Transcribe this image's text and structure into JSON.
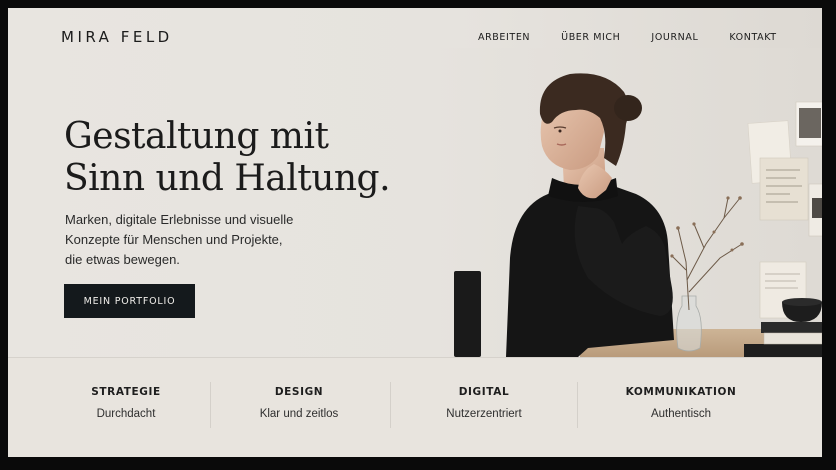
{
  "header": {
    "logo": "MIRA FELD",
    "nav": [
      {
        "label": "ARBEITEN"
      },
      {
        "label": "ÜBER MICH"
      },
      {
        "label": "JOURNAL"
      },
      {
        "label": "KONTAKT"
      }
    ]
  },
  "hero": {
    "headline_line1": "Gestaltung mit",
    "headline_line2": "Sinn und Haltung.",
    "sub_line1": "Marken, digitale Erlebnisse und visuelle",
    "sub_line2": "Konzepte für Menschen und Projekte,",
    "sub_line3": "die etwas bewegen.",
    "cta_label": "MEIN PORTFOLIO"
  },
  "features": [
    {
      "title": "STRATEGIE",
      "subtitle": "Durchdacht"
    },
    {
      "title": "DESIGN",
      "subtitle": "Klar und zeitlos"
    },
    {
      "title": "DIGITAL",
      "subtitle": "Nutzerzentriert"
    },
    {
      "title": "KOMMUNIKATION",
      "subtitle": "Authentisch"
    }
  ],
  "colors": {
    "background": "#e9e6e1",
    "text": "#1b1b1b",
    "button": "#14191c",
    "button_text": "#f1efeb"
  }
}
